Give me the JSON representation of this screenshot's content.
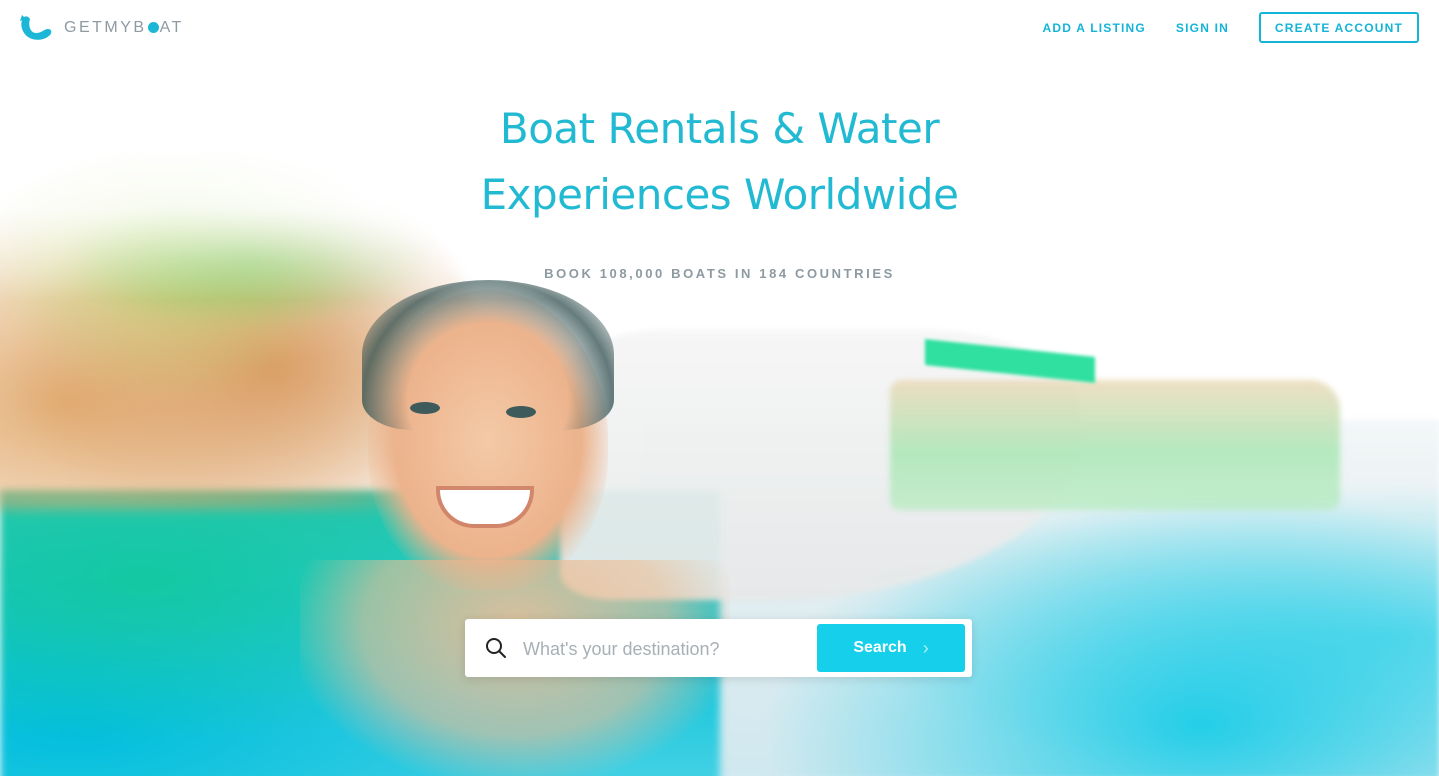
{
  "brand": {
    "name_part1": "GETMYB",
    "name_part2": "AT",
    "accent_color": "#14b4d8",
    "logo_icon": "whale-logo-icon"
  },
  "nav": {
    "add_listing": "ADD A LISTING",
    "sign_in": "SIGN IN",
    "create_account": "CREATE ACCOUNT"
  },
  "hero": {
    "title_line1": "Boat Rentals & Water",
    "title_line2": "Experiences Worldwide",
    "subtitle": "BOOK 108,000 BOATS IN 184 COUNTRIES"
  },
  "search": {
    "placeholder": "What's your destination?",
    "value": "",
    "button_label": "Search",
    "button_color": "#16cfea",
    "search_icon": "search-icon",
    "button_icon": "chevron-right-icon"
  }
}
